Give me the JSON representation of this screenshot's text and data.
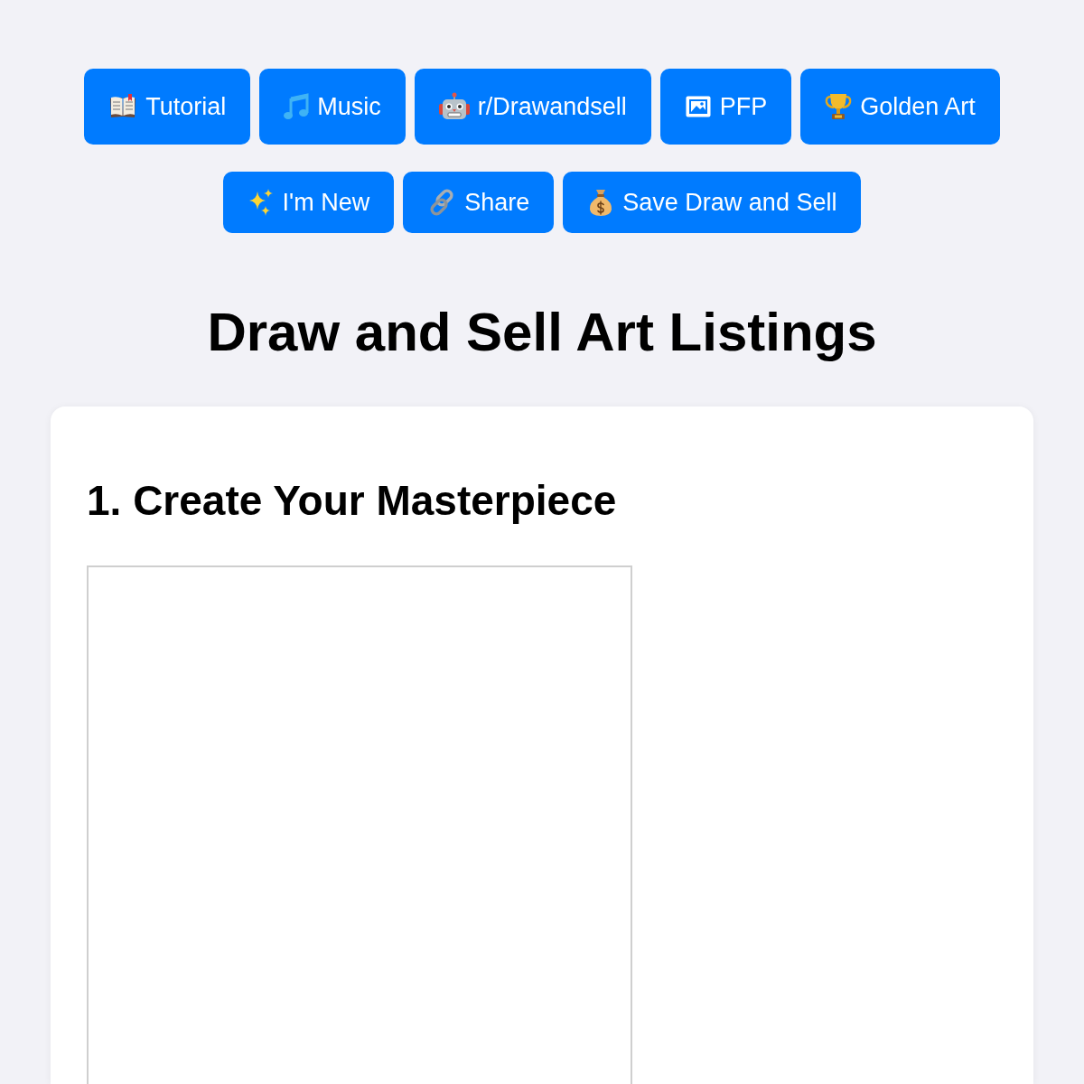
{
  "nav_rows": [
    {
      "buttons": [
        {
          "kind": "book",
          "label": "Tutorial"
        },
        {
          "kind": "note",
          "label": "Music"
        },
        {
          "kind": "robot",
          "label": "r/Drawandsell"
        },
        {
          "kind": "frame",
          "label": "PFP"
        },
        {
          "kind": "trophy",
          "label": "Golden Art"
        }
      ]
    },
    {
      "buttons": [
        {
          "kind": "sparkles",
          "label": "I'm New"
        },
        {
          "kind": "link",
          "label": "Share"
        },
        {
          "kind": "moneybag",
          "label": "Save Draw and Sell"
        }
      ]
    }
  ],
  "title": "Draw and Sell Art Listings",
  "card": {
    "heading": "1. Create Your Masterpiece"
  }
}
